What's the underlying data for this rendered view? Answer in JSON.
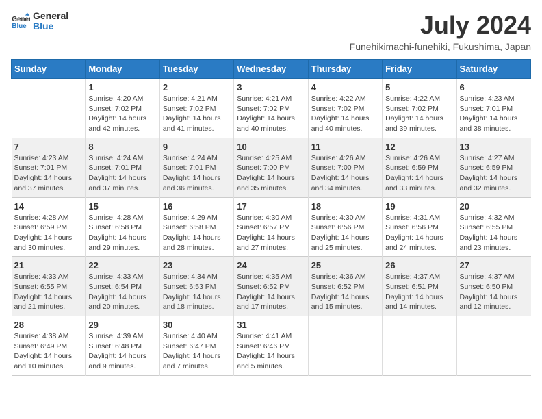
{
  "logo": {
    "text_general": "General",
    "text_blue": "Blue"
  },
  "header": {
    "title": "July 2024",
    "subtitle": "Funehikimachi-funehiki, Fukushima, Japan"
  },
  "days_of_week": [
    "Sunday",
    "Monday",
    "Tuesday",
    "Wednesday",
    "Thursday",
    "Friday",
    "Saturday"
  ],
  "weeks": [
    [
      {
        "day": "",
        "info": ""
      },
      {
        "day": "1",
        "info": "Sunrise: 4:20 AM\nSunset: 7:02 PM\nDaylight: 14 hours\nand 42 minutes."
      },
      {
        "day": "2",
        "info": "Sunrise: 4:21 AM\nSunset: 7:02 PM\nDaylight: 14 hours\nand 41 minutes."
      },
      {
        "day": "3",
        "info": "Sunrise: 4:21 AM\nSunset: 7:02 PM\nDaylight: 14 hours\nand 40 minutes."
      },
      {
        "day": "4",
        "info": "Sunrise: 4:22 AM\nSunset: 7:02 PM\nDaylight: 14 hours\nand 40 minutes."
      },
      {
        "day": "5",
        "info": "Sunrise: 4:22 AM\nSunset: 7:02 PM\nDaylight: 14 hours\nand 39 minutes."
      },
      {
        "day": "6",
        "info": "Sunrise: 4:23 AM\nSunset: 7:01 PM\nDaylight: 14 hours\nand 38 minutes."
      }
    ],
    [
      {
        "day": "7",
        "info": "Sunrise: 4:23 AM\nSunset: 7:01 PM\nDaylight: 14 hours\nand 37 minutes."
      },
      {
        "day": "8",
        "info": "Sunrise: 4:24 AM\nSunset: 7:01 PM\nDaylight: 14 hours\nand 37 minutes."
      },
      {
        "day": "9",
        "info": "Sunrise: 4:24 AM\nSunset: 7:01 PM\nDaylight: 14 hours\nand 36 minutes."
      },
      {
        "day": "10",
        "info": "Sunrise: 4:25 AM\nSunset: 7:00 PM\nDaylight: 14 hours\nand 35 minutes."
      },
      {
        "day": "11",
        "info": "Sunrise: 4:26 AM\nSunset: 7:00 PM\nDaylight: 14 hours\nand 34 minutes."
      },
      {
        "day": "12",
        "info": "Sunrise: 4:26 AM\nSunset: 6:59 PM\nDaylight: 14 hours\nand 33 minutes."
      },
      {
        "day": "13",
        "info": "Sunrise: 4:27 AM\nSunset: 6:59 PM\nDaylight: 14 hours\nand 32 minutes."
      }
    ],
    [
      {
        "day": "14",
        "info": "Sunrise: 4:28 AM\nSunset: 6:59 PM\nDaylight: 14 hours\nand 30 minutes."
      },
      {
        "day": "15",
        "info": "Sunrise: 4:28 AM\nSunset: 6:58 PM\nDaylight: 14 hours\nand 29 minutes."
      },
      {
        "day": "16",
        "info": "Sunrise: 4:29 AM\nSunset: 6:58 PM\nDaylight: 14 hours\nand 28 minutes."
      },
      {
        "day": "17",
        "info": "Sunrise: 4:30 AM\nSunset: 6:57 PM\nDaylight: 14 hours\nand 27 minutes."
      },
      {
        "day": "18",
        "info": "Sunrise: 4:30 AM\nSunset: 6:56 PM\nDaylight: 14 hours\nand 25 minutes."
      },
      {
        "day": "19",
        "info": "Sunrise: 4:31 AM\nSunset: 6:56 PM\nDaylight: 14 hours\nand 24 minutes."
      },
      {
        "day": "20",
        "info": "Sunrise: 4:32 AM\nSunset: 6:55 PM\nDaylight: 14 hours\nand 23 minutes."
      }
    ],
    [
      {
        "day": "21",
        "info": "Sunrise: 4:33 AM\nSunset: 6:55 PM\nDaylight: 14 hours\nand 21 minutes."
      },
      {
        "day": "22",
        "info": "Sunrise: 4:33 AM\nSunset: 6:54 PM\nDaylight: 14 hours\nand 20 minutes."
      },
      {
        "day": "23",
        "info": "Sunrise: 4:34 AM\nSunset: 6:53 PM\nDaylight: 14 hours\nand 18 minutes."
      },
      {
        "day": "24",
        "info": "Sunrise: 4:35 AM\nSunset: 6:52 PM\nDaylight: 14 hours\nand 17 minutes."
      },
      {
        "day": "25",
        "info": "Sunrise: 4:36 AM\nSunset: 6:52 PM\nDaylight: 14 hours\nand 15 minutes."
      },
      {
        "day": "26",
        "info": "Sunrise: 4:37 AM\nSunset: 6:51 PM\nDaylight: 14 hours\nand 14 minutes."
      },
      {
        "day": "27",
        "info": "Sunrise: 4:37 AM\nSunset: 6:50 PM\nDaylight: 14 hours\nand 12 minutes."
      }
    ],
    [
      {
        "day": "28",
        "info": "Sunrise: 4:38 AM\nSunset: 6:49 PM\nDaylight: 14 hours\nand 10 minutes."
      },
      {
        "day": "29",
        "info": "Sunrise: 4:39 AM\nSunset: 6:48 PM\nDaylight: 14 hours\nand 9 minutes."
      },
      {
        "day": "30",
        "info": "Sunrise: 4:40 AM\nSunset: 6:47 PM\nDaylight: 14 hours\nand 7 minutes."
      },
      {
        "day": "31",
        "info": "Sunrise: 4:41 AM\nSunset: 6:46 PM\nDaylight: 14 hours\nand 5 minutes."
      },
      {
        "day": "",
        "info": ""
      },
      {
        "day": "",
        "info": ""
      },
      {
        "day": "",
        "info": ""
      }
    ]
  ]
}
